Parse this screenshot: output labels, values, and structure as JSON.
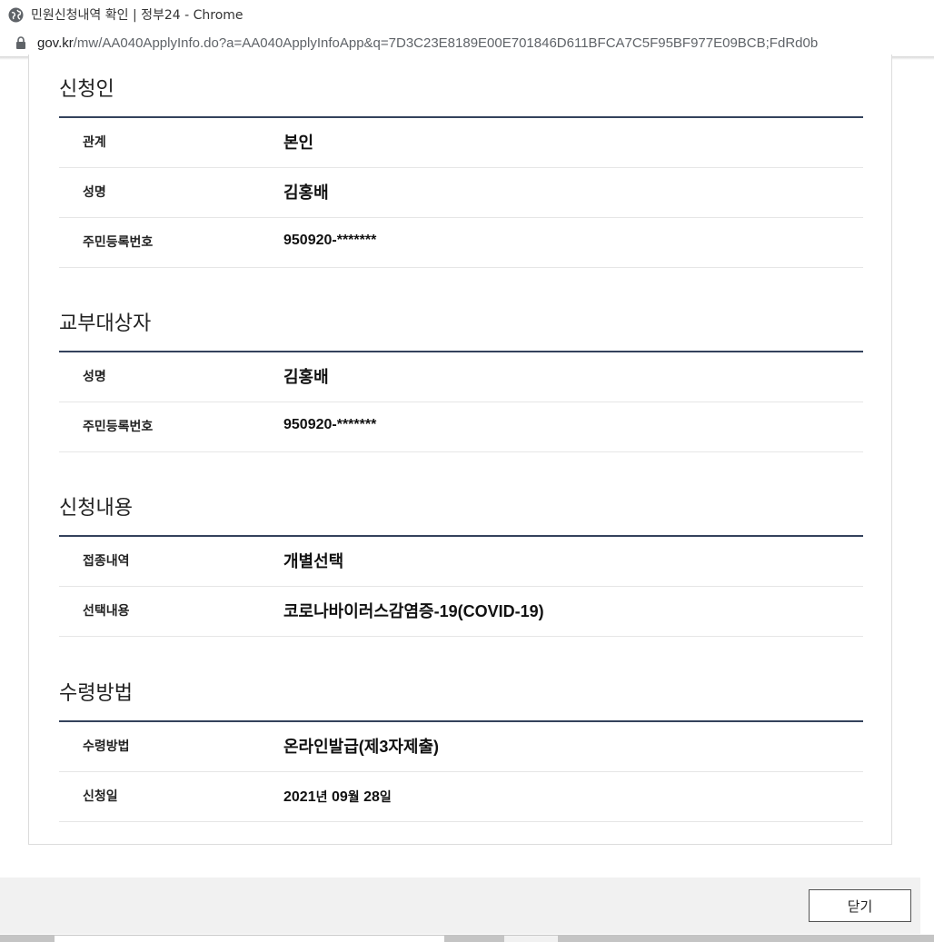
{
  "window": {
    "title": "민원신청내역 확인 | 정부24 - Chrome",
    "url_host": "gov.kr",
    "url_path": "/mw/AA040ApplyInfo.do?a=AA040ApplyInfoApp&q=7D3C23E8189E00E701846D611BFCA7C5F95BF977E09BCB;FdRd0b"
  },
  "sections": [
    {
      "title": "신청인",
      "rows": [
        {
          "label": "관계",
          "value": "본인"
        },
        {
          "label": "성명",
          "value": "김홍배"
        },
        {
          "label": "주민등록번호",
          "value": "950920-*******"
        }
      ]
    },
    {
      "title": "교부대상자",
      "rows": [
        {
          "label": "성명",
          "value": "김홍배"
        },
        {
          "label": "주민등록번호",
          "value": "950920-*******"
        }
      ]
    },
    {
      "title": "신청내용",
      "rows": [
        {
          "label": "접종내역",
          "value": "개별선택"
        },
        {
          "label": "선택내용",
          "value": "코로나바이러스감염증-19(COVID-19)"
        }
      ]
    },
    {
      "title": "수령방법",
      "rows": [
        {
          "label": "수령방법",
          "value": "온라인발급(제3자제출)"
        },
        {
          "label": "신청일",
          "value_parts": {
            "year": "2021",
            "year_unit": "년",
            "month": "09",
            "month_unit": "월",
            "day": "28",
            "day_unit": "일"
          }
        }
      ]
    }
  ],
  "footer": {
    "close_label": "닫기"
  },
  "colors": {
    "rule": "#34425c",
    "footer_bg": "#f1f1f1"
  }
}
